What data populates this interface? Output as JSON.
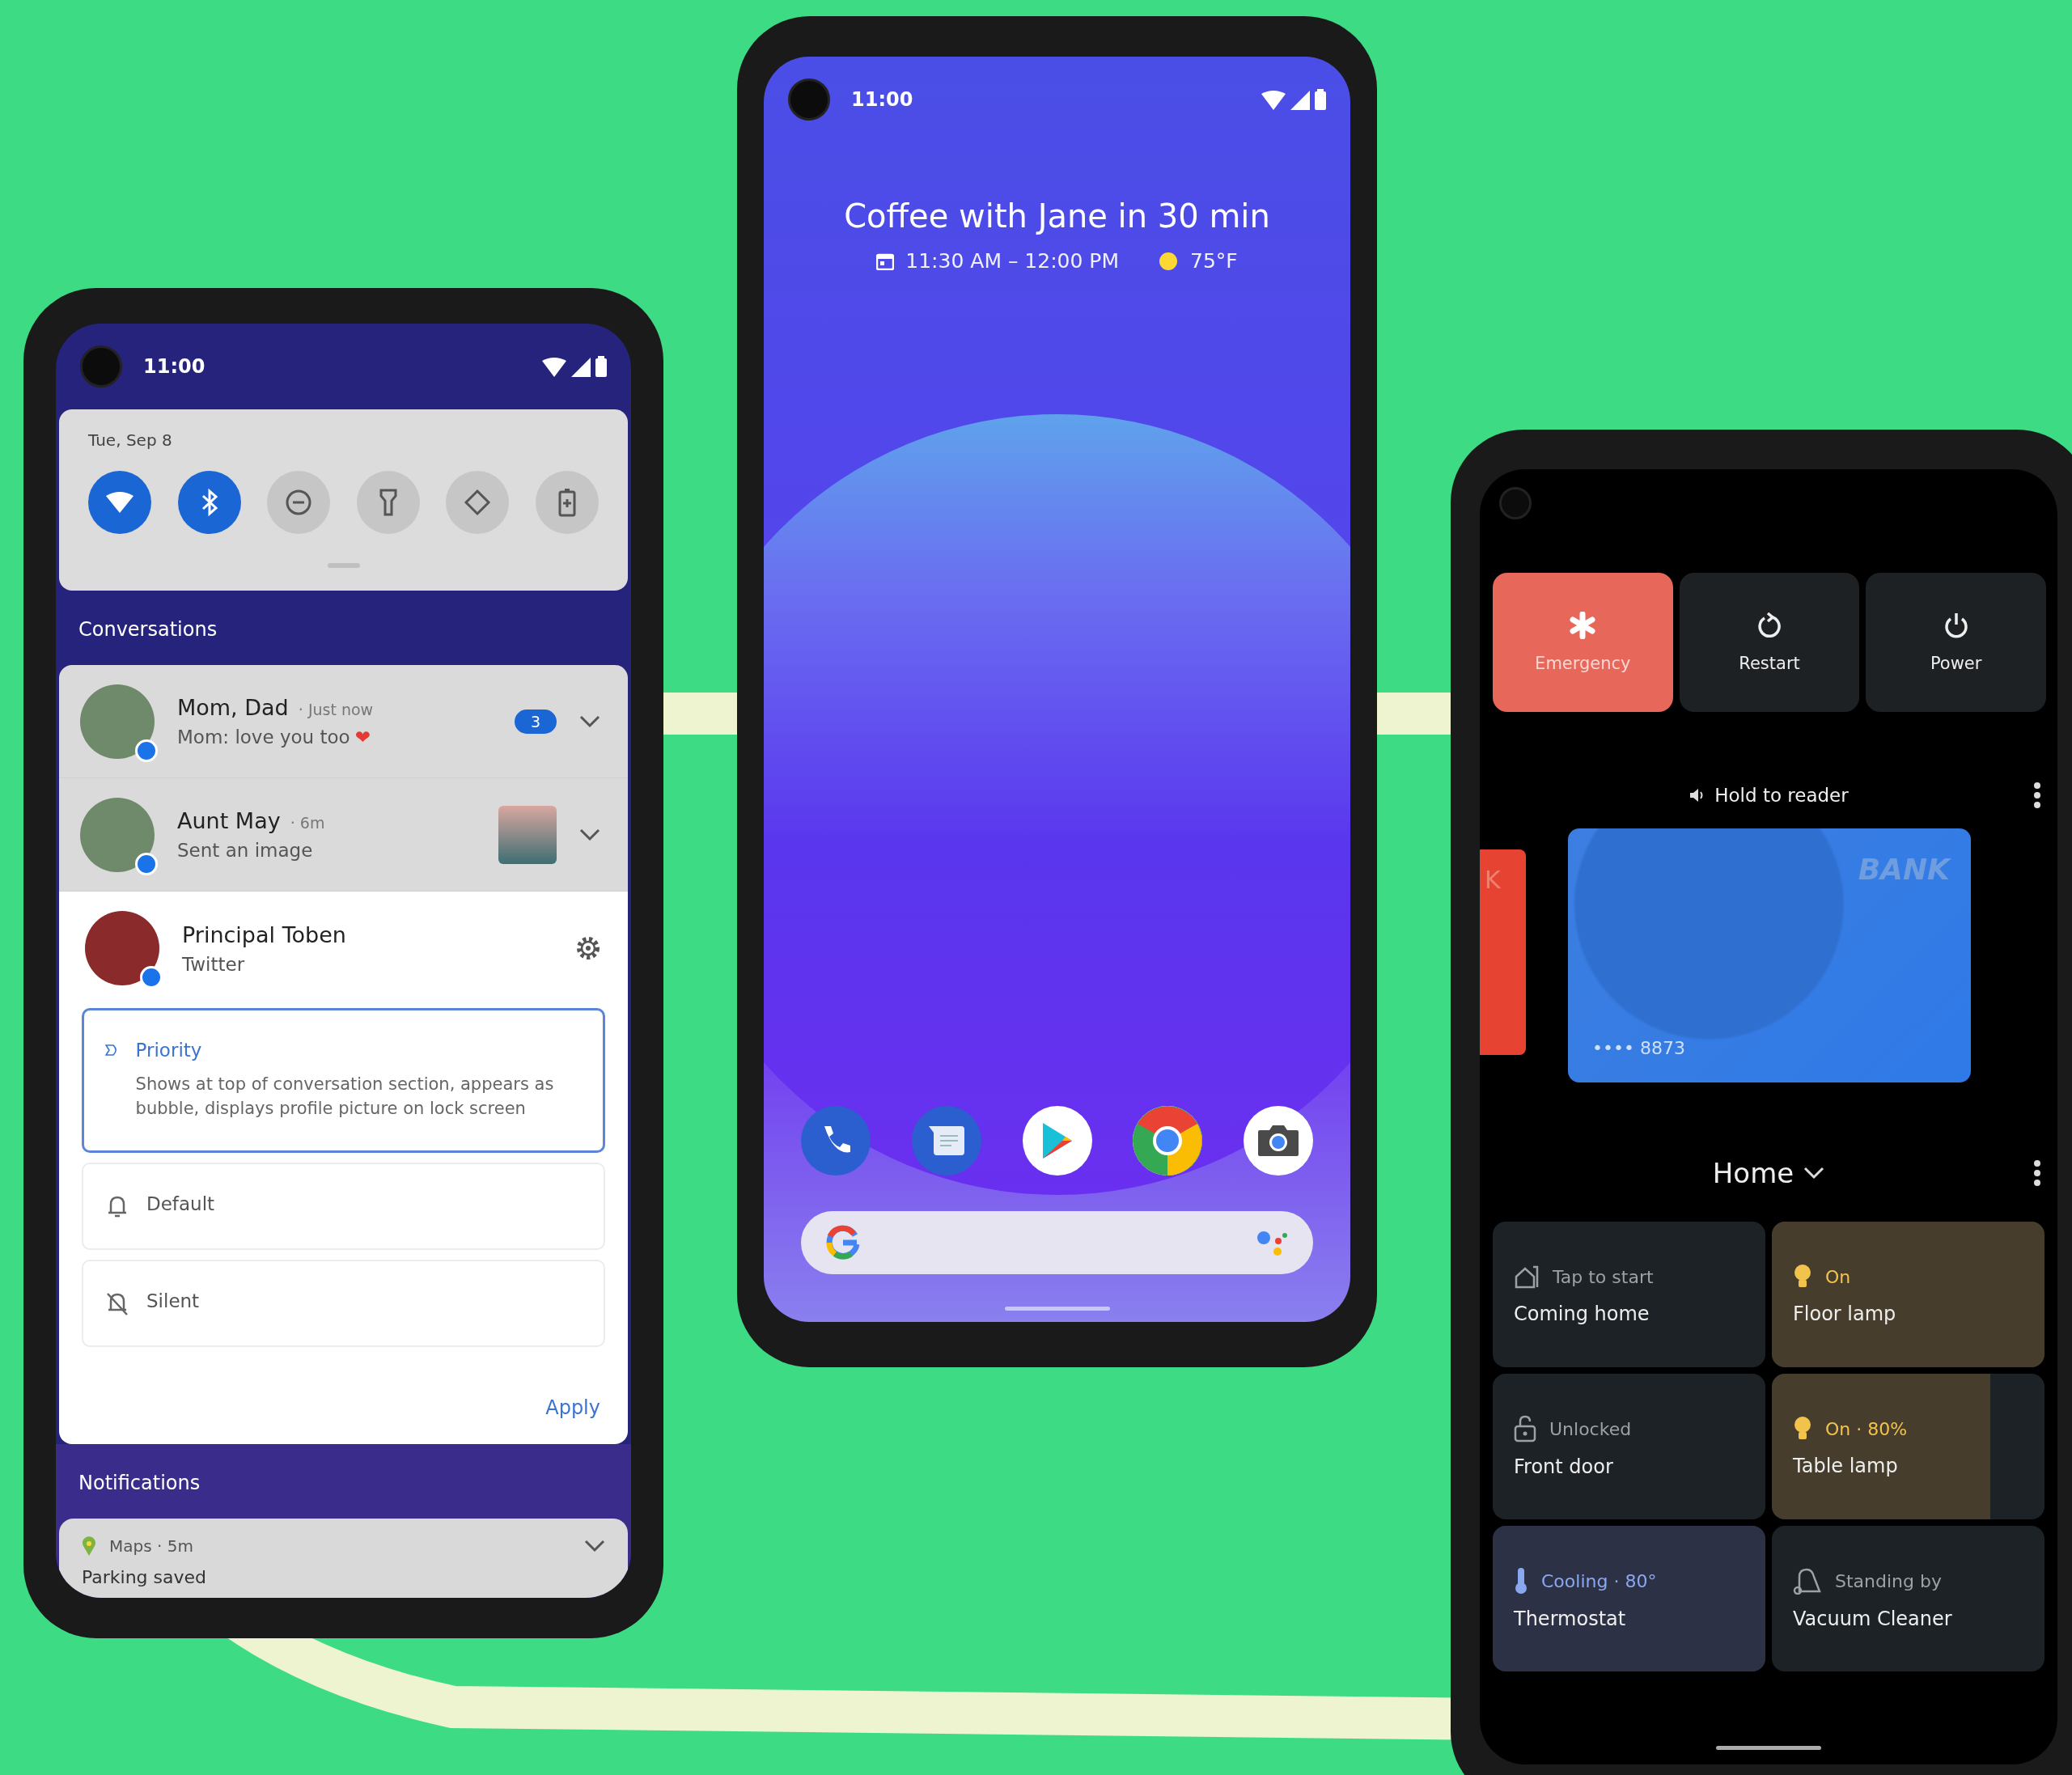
{
  "left_phone": {
    "status_bar": {
      "time": "11:00"
    },
    "quick_settings": {
      "date": "Tue, Sep 8",
      "tiles": [
        {
          "kind": "wifi",
          "on": true
        },
        {
          "kind": "bluetooth",
          "on": true
        },
        {
          "kind": "do_not_disturb",
          "on": false
        },
        {
          "kind": "flashlight",
          "on": false
        },
        {
          "kind": "auto_rotate",
          "on": false
        },
        {
          "kind": "battery_saver",
          "on": false
        }
      ]
    },
    "conversations": {
      "header": "Conversations",
      "items": [
        {
          "name": "Mom, Dad",
          "separator": "·",
          "time": "Just now",
          "message": "Mom: love you too",
          "reaction": "❤",
          "badge": "3"
        },
        {
          "name": "Aunt May",
          "separator": "·",
          "time": "6m",
          "message": "Sent an image",
          "thumbnail": true
        }
      ]
    },
    "expanded": {
      "name": "Principal Toben",
      "app": "Twitter",
      "options": [
        {
          "kind": "priority",
          "label": "Priority",
          "description": "Shows at top of conversation section, appears as bubble, displays profile picture on lock screen",
          "selected": true
        },
        {
          "kind": "default",
          "label": "Default",
          "selected": false
        },
        {
          "kind": "silent",
          "label": "Silent",
          "selected": false
        }
      ],
      "apply": "Apply"
    },
    "notifications": {
      "header": "Notifications",
      "items": [
        {
          "app": "Maps",
          "separator": "·",
          "time": "5m",
          "title": "Parking saved"
        }
      ]
    }
  },
  "middle_phone": {
    "status_bar": {
      "time": "11:00"
    },
    "glance": {
      "title": "Coffee with Jane in 30 min",
      "event_time": "11:30 AM – 12:00 PM",
      "temperature": "75°F"
    },
    "dock": [
      {
        "kind": "phone"
      },
      {
        "kind": "messages"
      },
      {
        "kind": "play_store"
      },
      {
        "kind": "chrome"
      },
      {
        "kind": "camera"
      }
    ]
  },
  "right_phone": {
    "power_menu": [
      {
        "kind": "emergency",
        "label": "Emergency"
      },
      {
        "kind": "restart",
        "label": "Restart"
      },
      {
        "kind": "power",
        "label": "Power"
      }
    ],
    "wallet": {
      "prompt": "Hold to reader",
      "peek_card": "K",
      "card": {
        "bank": "BANK",
        "number": "•••• 8873"
      }
    },
    "controls": {
      "title": "Home",
      "tiles": [
        {
          "kind": "routine",
          "status": "Tap to start",
          "name": "Coming home",
          "on": false
        },
        {
          "kind": "light",
          "status": "On",
          "name": "Floor lamp",
          "on": true
        },
        {
          "kind": "lock",
          "status": "Unlocked",
          "name": "Front door",
          "on": false
        },
        {
          "kind": "light",
          "status": "On · 80%",
          "name": "Table lamp",
          "on": true,
          "level": 0.8
        },
        {
          "kind": "thermostat",
          "status": "Cooling · 80°",
          "name": "Thermostat",
          "on": true
        },
        {
          "kind": "vacuum",
          "status": "Standing by",
          "name": "Vacuum Cleaner",
          "on": false
        }
      ]
    }
  }
}
